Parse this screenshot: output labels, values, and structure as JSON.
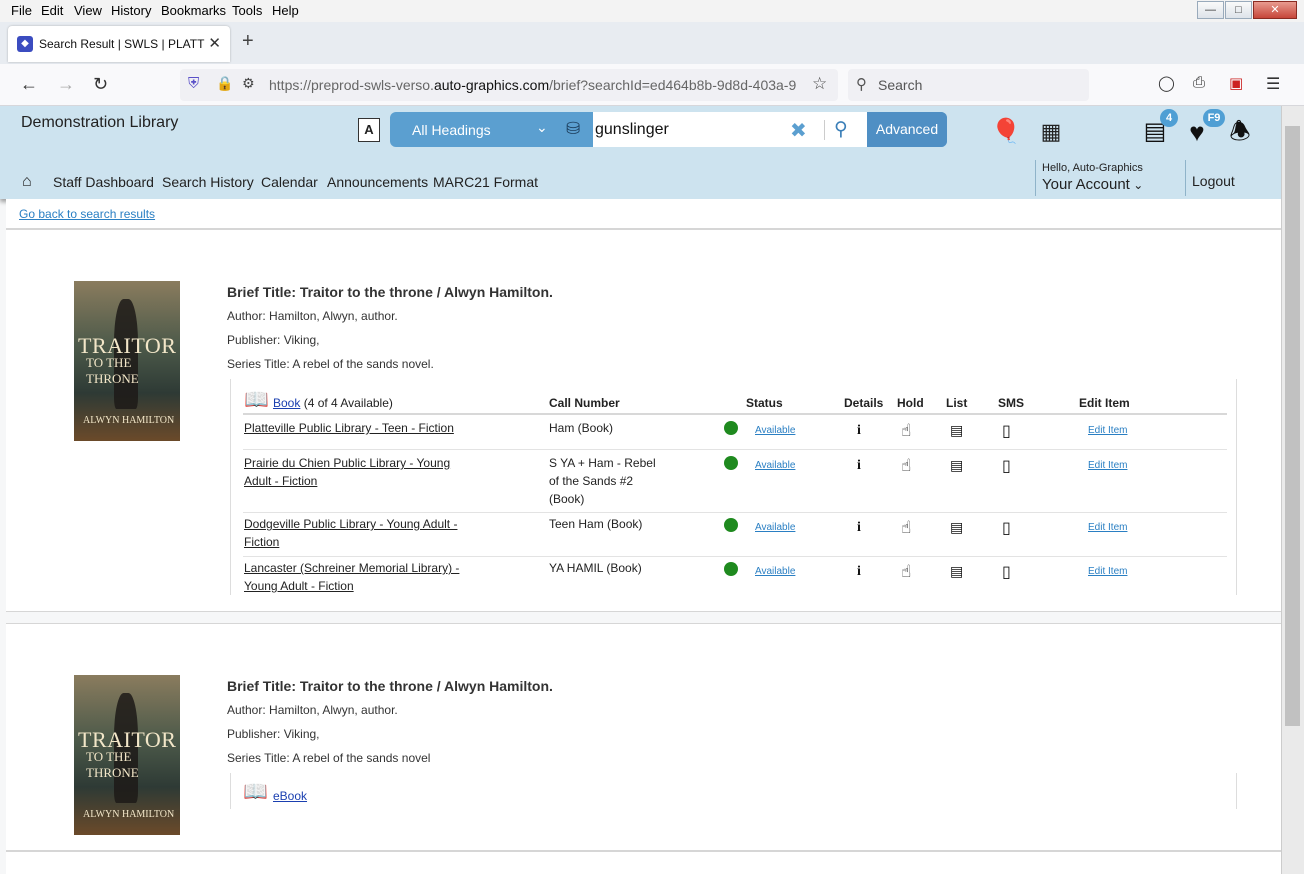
{
  "browser": {
    "menu": [
      "File",
      "Edit",
      "View",
      "History",
      "Bookmarks",
      "Tools",
      "Help"
    ],
    "tab_title": "Search Result | SWLS | PLATT | A",
    "url_prefix": "https://preprod-swls-verso.",
    "url_domain": "auto-graphics.com",
    "url_rest": "/brief?searchId=ed464b8b-9d8d-403a-9",
    "search_placeholder": "Search"
  },
  "header": {
    "library_name": "Demonstration Library",
    "heading_select": "All Headings",
    "search_value": "gunslinger",
    "advanced_label": "Advanced",
    "list_count": "4",
    "fav_badge": "F9",
    "nav": [
      "Staff Dashboard",
      "Search History",
      "Calendar",
      "Announcements",
      "MARC21 Format"
    ],
    "hello": "Hello, Auto-Graphics",
    "account": "Your Account",
    "logout": "Logout"
  },
  "back_link": "Go back to search results",
  "results": [
    {
      "title": "Brief Title: Traitor to the throne / Alwyn Hamilton.",
      "author": "Author: Hamilton, Alwyn, author.",
      "publisher": "Publisher: Viking,",
      "series": "Series Title: A rebel of the sands novel.",
      "format_link": "Book",
      "format_avail": "(4 of 4 Available)",
      "columns": [
        "Call Number",
        "Status",
        "Details",
        "Hold",
        "List",
        "SMS",
        "Edit Item"
      ],
      "holdings": [
        {
          "library": [
            "Platteville Public Library - Teen - Fiction"
          ],
          "call": [
            "Ham (Book)"
          ],
          "status": "Available",
          "edit": "Edit Item"
        },
        {
          "library": [
            "Prairie du Chien Public Library - Young",
            "Adult - Fiction"
          ],
          "call": [
            "S YA + Ham - Rebel",
            "of the Sands #2",
            "(Book)"
          ],
          "status": "Available",
          "edit": "Edit Item"
        },
        {
          "library": [
            "Dodgeville Public Library - Young Adult -",
            "Fiction"
          ],
          "call": [
            "Teen Ham (Book)"
          ],
          "status": "Available",
          "edit": "Edit Item"
        },
        {
          "library": [
            "Lancaster (Schreiner Memorial Library) -",
            "Young Adult - Fiction"
          ],
          "call": [
            "YA HAMIL (Book)"
          ],
          "status": "Available",
          "edit": "Edit Item"
        }
      ]
    },
    {
      "title": "Brief Title: Traitor to the throne / Alwyn Hamilton.",
      "author": "Author: Hamilton, Alwyn, author.",
      "publisher": "Publisher: Viking,",
      "series": "Series Title: A rebel of the sands novel",
      "format_link": "eBook"
    }
  ],
  "cover": {
    "line1": "TRAITOR",
    "line2": "TO THE THRONE",
    "author": "ALWYN HAMILTON"
  }
}
